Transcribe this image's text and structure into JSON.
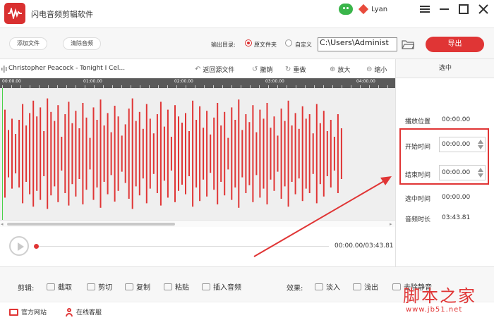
{
  "app": {
    "title": "闪电音频剪辑软件",
    "username": "Lyan",
    "window_controls": [
      "menu",
      "minimize",
      "maximize",
      "close"
    ]
  },
  "toolbar": {
    "add_file": "添加文件",
    "clear_audio": "清除音频",
    "output_dir_label": "输出目录:",
    "radio_original": "原文件夹",
    "radio_custom": "自定义",
    "selected_output": "原文件夹",
    "path_value": "C:\\Users\\Administ",
    "export": "导出"
  },
  "filebar": {
    "filename": "Christopher Peacock - Tonight I Cel...",
    "undo_source": "返回源文件",
    "undo": "撤销",
    "redo": "重做",
    "zoom_in": "放大",
    "zoom_out": "缩小"
  },
  "ruler": {
    "labels": [
      "00:00.00",
      "01:00.00",
      "02:00.00",
      "03:00.00",
      "04:00.00"
    ]
  },
  "player": {
    "time": "00:00.00/03:43.81"
  },
  "side": {
    "header": "选中",
    "play_position_label": "播放位置",
    "play_position_value": "00:00.00",
    "start_label": "开始时间",
    "start_value": "00:00.00",
    "end_label": "结束时间",
    "end_value": "00:00.00",
    "selection_label": "选中时间",
    "selection_value": "00:00.00",
    "duration_label": "音频时长",
    "duration_value": "03:43.81"
  },
  "edit": {
    "label": "剪辑:",
    "cut": "截取",
    "clip": "剪切",
    "copy": "复制",
    "paste": "粘贴",
    "insert": "插入音频",
    "effects_label": "效果:",
    "fade_in": "淡入",
    "fade_out": "浅出",
    "remove_silence": "去除静音"
  },
  "footer": {
    "website": "官方网站",
    "support": "在线客服"
  },
  "watermark": {
    "main": "脚本之家",
    "sub": "www.jb51.net"
  },
  "colors": {
    "accent": "#e03535",
    "waveform": "#e03535",
    "playhead": "#4ad24a",
    "ruler": "#5a5a5a"
  },
  "waveform": {
    "amplitudes": [
      0.78,
      0.42,
      0.62,
      0.35,
      0.6,
      0.88,
      0.5,
      0.72,
      0.94,
      0.66,
      0.82,
      0.4,
      0.98,
      0.74,
      0.58,
      0.86,
      0.3,
      0.7,
      0.92,
      0.54,
      0.76,
      0.45,
      0.9,
      0.64,
      0.28,
      0.82,
      0.6,
      0.96,
      0.5,
      0.72,
      0.38,
      0.85,
      0.66,
      0.32,
      0.52,
      0.8,
      0.98,
      0.58,
      0.74,
      0.44,
      0.88,
      0.62,
      0.36,
      0.7,
      0.92,
      0.48,
      0.78,
      0.3,
      0.86,
      0.66,
      0.55,
      0.72,
      0.4,
      0.94,
      0.6,
      0.84,
      0.46,
      0.76,
      0.34,
      0.64,
      0.9,
      0.5,
      0.74,
      0.28,
      0.82,
      0.6,
      0.96,
      0.42,
      0.7,
      0.56,
      0.86,
      0.38,
      0.78,
      0.62,
      0.9,
      0.46,
      0.66,
      0.32,
      0.8,
      0.58,
      0.94,
      0.5,
      0.72,
      0.44,
      0.84,
      0.62,
      0.7,
      0.36,
      0.88,
      0.54,
      0.76,
      0.4,
      0.6,
      0.3,
      0.7,
      0.45
    ]
  }
}
